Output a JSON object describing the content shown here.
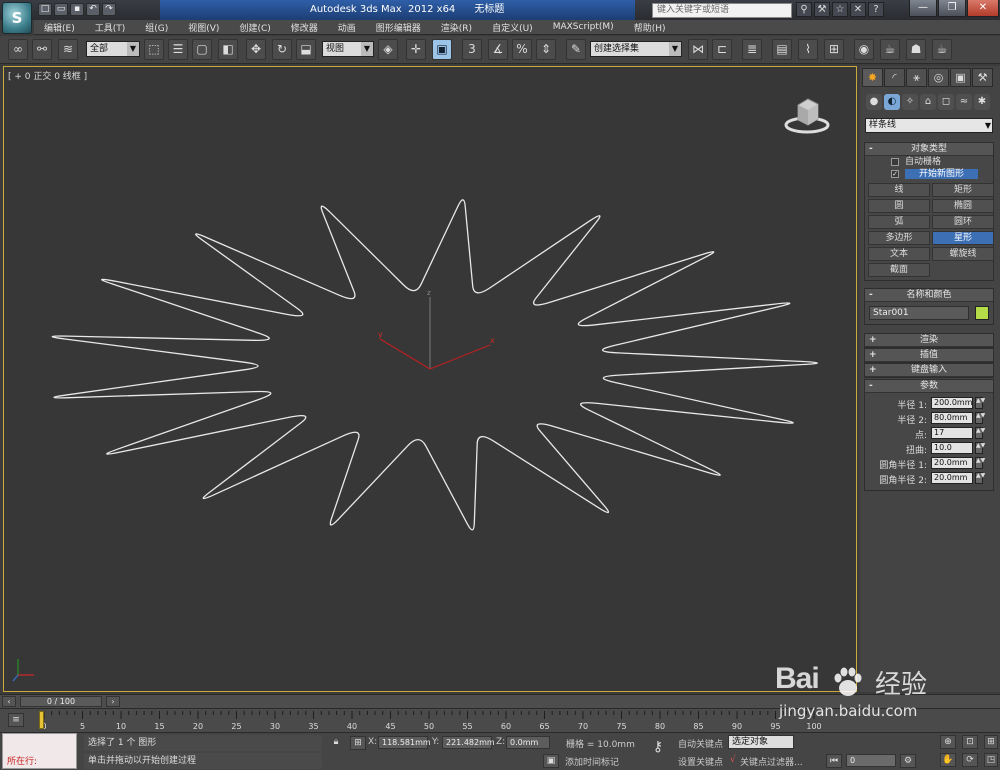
{
  "titlebar": {
    "app_logo": "S",
    "app_title": "Autodesk 3ds Max  2012 x64",
    "doc_title": "无标题",
    "help_search_placeholder": "键入关键字或短语",
    "quick_access": [
      "new",
      "open",
      "save",
      "undo",
      "redo"
    ],
    "win_minimize": "—",
    "win_restore": "❐",
    "win_close": "✕"
  },
  "menu": [
    "编辑(E)",
    "工具(T)",
    "组(G)",
    "视图(V)",
    "创建(C)",
    "修改器",
    "动画",
    "图形编辑器",
    "渲染(R)",
    "自定义(U)",
    "MAXScript(M)",
    "帮助(H)"
  ],
  "toolbar": {
    "selection_filter": "全部",
    "ref_coord": "视图",
    "named_selection": "创建选择集"
  },
  "viewport": {
    "label": "[ + 0 正交 0 线框 ]",
    "axis_x": "x",
    "axis_y": "y",
    "axis_z": "z"
  },
  "cmdpanel": {
    "category": "样条线",
    "object_type": {
      "title": "对象类型",
      "autogrid_label": "自动栅格",
      "start_new_shape_label": "开始新图形",
      "buttons": [
        "线",
        "矩形",
        "圆",
        "椭圆",
        "弧",
        "圆环",
        "多边形",
        "星形",
        "文本",
        "螺旋线",
        "截面"
      ],
      "active_button": "星形"
    },
    "name_color": {
      "title": "名称和颜色",
      "object_name": "Star001",
      "object_color": "#b4dc48"
    },
    "collapsed_rollouts": [
      "渲染",
      "插值",
      "键盘输入"
    ],
    "parameters": {
      "title": "参数",
      "rows": [
        {
          "label": "半径 1:",
          "value": "200.0mm"
        },
        {
          "label": "半径 2:",
          "value": "80.0mm"
        },
        {
          "label": "点:",
          "value": "17"
        },
        {
          "label": "扭曲:",
          "value": "10.0"
        },
        {
          "label": "圆角半径 1:",
          "value": "20.0mm"
        },
        {
          "label": "圆角半径 2:",
          "value": "20.0mm"
        }
      ]
    }
  },
  "timeline": {
    "frame_display": "0 / 100",
    "ticks": [
      "0",
      "5",
      "10",
      "15",
      "20",
      "25",
      "30",
      "35",
      "40",
      "45",
      "50",
      "55",
      "60",
      "65",
      "70",
      "75",
      "80",
      "85",
      "90",
      "95",
      "100"
    ]
  },
  "status": {
    "maxscript_label": "所在行:",
    "selection_text": "选择了 1 个 图形",
    "prompt_text": "单击并拖动以开始创建过程",
    "x_label": "X:",
    "x_value": "118.581mm",
    "y_label": "Y:",
    "y_value": "221.482mm",
    "z_label": "Z:",
    "z_value": "0.0mm",
    "grid_text": "栅格 = 10.0mm",
    "add_time_tag": "添加时间标记",
    "auto_key": "自动关键点",
    "selected_object": "选定对象",
    "set_key": "设置关键点",
    "key_filters": "关键点过滤器...",
    "frame_field": "0"
  },
  "watermark": {
    "brand": "Bai",
    "brand_cn": "经验",
    "url": "jingyan.baidu.com"
  }
}
